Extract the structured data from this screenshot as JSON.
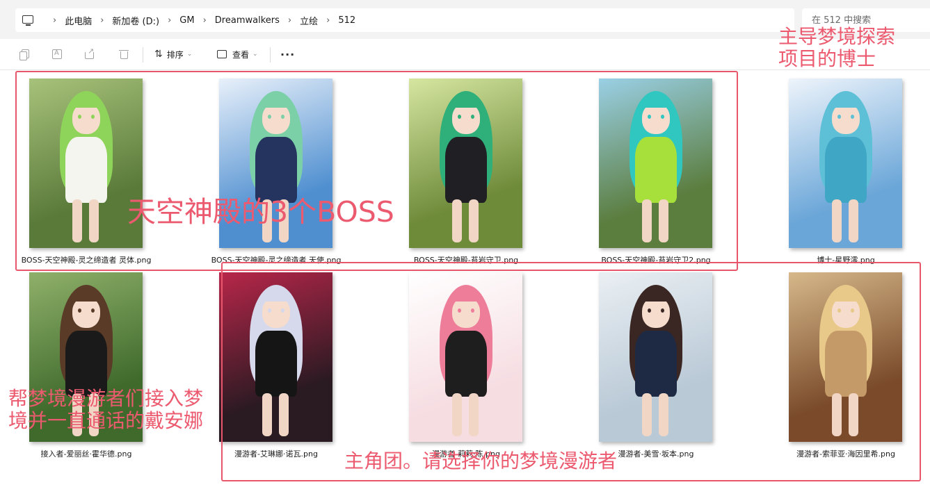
{
  "address": {
    "crumbs": [
      "此电脑",
      "新加卷 (D:)",
      "GM",
      "Dreamwalkers",
      "立绘",
      "512"
    ],
    "search_placeholder": "在 512 中搜索"
  },
  "toolbar": {
    "sort_label": "排序",
    "view_label": "查看",
    "more_label": "···"
  },
  "files": [
    {
      "name": "BOSS-天空神殿-灵之缔造者 灵体.png",
      "palette": {
        "bg": "#5a7a3a",
        "bg2": "#a7c27a",
        "hair": "#8fd45a",
        "outfit": "#f5f5f0"
      }
    },
    {
      "name": "BOSS-天空神殿-灵之缔造者 天使.png",
      "palette": {
        "bg": "#4f8fd0",
        "bg2": "#e8f0fa",
        "hair": "#7bd0a8",
        "outfit": "#24345e"
      }
    },
    {
      "name": "BOSS-天空神殿-苔岩守卫.png",
      "palette": {
        "bg": "#6e8b3a",
        "bg2": "#d6e6a0",
        "hair": "#2fb07a",
        "outfit": "#1f1f24"
      }
    },
    {
      "name": "BOSS-天空神殿-苔岩守卫2.png",
      "palette": {
        "bg": "#5b7d3e",
        "bg2": "#9ad0e6",
        "hair": "#2fc7c0",
        "outfit": "#a7e03a"
      }
    },
    {
      "name": "博士-星野澪.png",
      "palette": {
        "bg": "#6aa6d8",
        "bg2": "#eef4fb",
        "hair": "#5ec0d6",
        "outfit": "#3fa6c6"
      }
    },
    {
      "name": "接入者-爱丽丝·霍华德.png",
      "palette": {
        "bg": "#3f6a2c",
        "bg2": "#8fb06a",
        "hair": "#5a3b28",
        "outfit": "#1a1a1a"
      }
    },
    {
      "name": "漫游者-艾琳娜·诺瓦.png",
      "palette": {
        "bg": "#2a1a22",
        "bg2": "#b8264a",
        "hair": "#d6d8ec",
        "outfit": "#151515"
      }
    },
    {
      "name": "漫游者-莉莉·陈.png",
      "palette": {
        "bg": "#f6dde2",
        "bg2": "#ffffff",
        "hair": "#ee7d9a",
        "outfit": "#1e1e1e"
      }
    },
    {
      "name": "漫游者-美雪·坂本.png",
      "palette": {
        "bg": "#b9c9d6",
        "bg2": "#eaeff3",
        "hair": "#3a2622",
        "outfit": "#1e2a44"
      }
    },
    {
      "name": "漫游者-索菲亚·海因里希.png",
      "palette": {
        "bg": "#7a4a2a",
        "bg2": "#d6b88a",
        "hair": "#e8c98a",
        "outfit": "#c49a68"
      }
    }
  ],
  "annotations": {
    "boss_note": "天空神殿的3个BOSS",
    "doctor_note": [
      "主导梦境探索",
      "项目的博士"
    ],
    "connector_note": [
      "帮梦境漫游者们接入梦",
      "境并一直通话的戴安娜"
    ],
    "team_note": "主角团。请选择你的梦境漫游者",
    "color": "#e8566c"
  }
}
